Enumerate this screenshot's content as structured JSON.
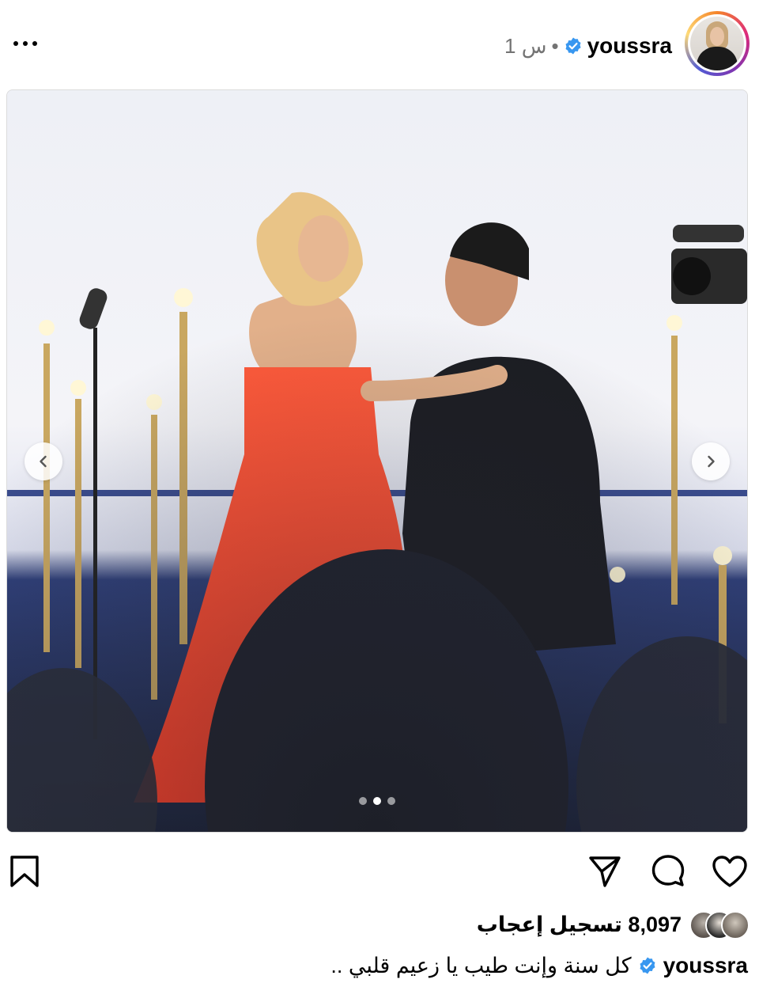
{
  "header": {
    "username": "youssra",
    "time": "1 س",
    "separator": "•",
    "more_icon": "more-horizontal-icon",
    "verified_icon": "verified-badge-icon"
  },
  "media": {
    "carousel_count": 3,
    "active_index": 1,
    "prev_icon": "chevron-left-icon",
    "next_icon": "chevron-right-icon"
  },
  "actions": {
    "like_icon": "heart-icon",
    "comment_icon": "comment-icon",
    "share_icon": "send-icon",
    "save_icon": "bookmark-icon"
  },
  "likes": {
    "count_text": "8,097 تسجيل إعجاب"
  },
  "caption": {
    "username": "youssra",
    "text": "كل سنة وإنت طيب يا زعيم قلبي .."
  },
  "colors": {
    "verified": "#3897f0",
    "muted_text": "#737373",
    "border": "#dbdbdb"
  }
}
